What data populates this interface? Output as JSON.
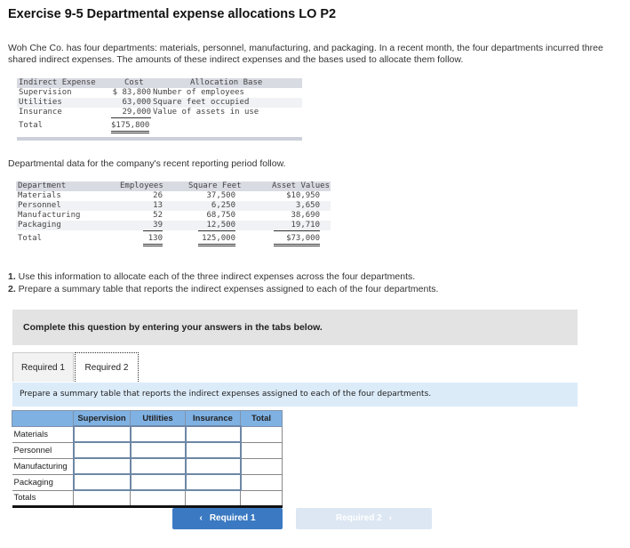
{
  "title": "Exercise 9-5 Departmental expense allocations LO P2",
  "intro": "Woh Che Co. has four departments: materials, personnel, manufacturing, and packaging. In a recent month, the four departments incurred three shared indirect expenses. The amounts of these indirect expenses and the bases used to allocate them follow.",
  "expenses": {
    "headers": [
      "Indirect Expense",
      "Cost",
      "Allocation Base"
    ],
    "rows": [
      [
        "Supervision",
        "$ 83,800",
        "Number of employees"
      ],
      [
        "Utilities",
        "63,000",
        "Square feet occupied"
      ],
      [
        "Insurance",
        "29,000",
        "Value of assets in use"
      ]
    ],
    "total": [
      "Total",
      "$175,800"
    ]
  },
  "dept_intro": "Departmental data for the company's recent reporting period follow.",
  "departments": {
    "headers": [
      "Department",
      "Employees",
      "Square Feet",
      "Asset Values"
    ],
    "rows": [
      [
        "Materials",
        "26",
        "37,500",
        "$10,950"
      ],
      [
        "Personnel",
        "13",
        "6,250",
        "3,650"
      ],
      [
        "Manufacturing",
        "52",
        "68,750",
        "38,690"
      ],
      [
        "Packaging",
        "39",
        "12,500",
        "19,710"
      ]
    ],
    "total": [
      "Total",
      "130",
      "125,000",
      "$73,000"
    ]
  },
  "q1_num": "1.",
  "q1": " Use this information to allocate each of the three indirect expenses across the four departments.",
  "q2_num": "2.",
  "q2": " Prepare a summary table that reports the indirect expenses assigned to each of the four departments.",
  "complete": "Complete this question by entering your answers in the tabs below.",
  "tabs": [
    "Required 1",
    "Required 2"
  ],
  "instruction": "Prepare a summary table that reports the indirect expenses assigned to each of the four departments.",
  "summary": {
    "headers": [
      "",
      "Supervision",
      "Utilities",
      "Insurance",
      "Total"
    ],
    "rows": [
      "Materials",
      "Personnel",
      "Manufacturing",
      "Packaging"
    ],
    "totals": "Totals"
  },
  "nav": {
    "prev": "Required 1",
    "next": "Required 2",
    "prev_icon": "‹",
    "next_icon": "›"
  }
}
